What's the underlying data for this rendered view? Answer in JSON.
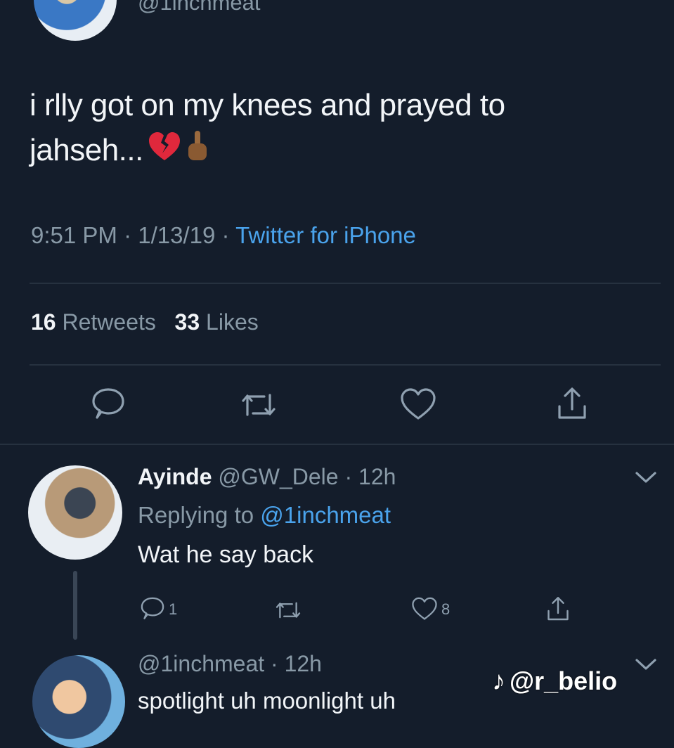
{
  "tweet": {
    "handle": "@1inchmeat",
    "text_line1": "i rlly got on my knees and prayed to",
    "text_line2": "jahseh...",
    "time": "9:51 PM",
    "date": "1/13/19",
    "source": "Twitter for iPhone",
    "retweets_count": "16",
    "retweets_label": "Retweets",
    "likes_count": "33",
    "likes_label": "Likes"
  },
  "reply1": {
    "name": "Ayinde",
    "handle": "@GW_Dele",
    "age": "12h",
    "replying_label": "Replying to",
    "replying_to": "@1inchmeat",
    "text": "Wat he say back",
    "reply_count": "1",
    "like_count": "8"
  },
  "reply2": {
    "handle": "@1inchmeat",
    "age": "12h",
    "text": "spotlight uh moonlight uh"
  },
  "watermark": {
    "logo": "♪",
    "text": "@r_belio"
  },
  "icons": [
    "reply-icon",
    "retweet-icon",
    "like-icon",
    "share-icon",
    "chevron-down-icon",
    "broken-heart-emoji",
    "pointing-up-emoji",
    "tiktok-logo-icon"
  ],
  "colors": {
    "background": "#141d2b",
    "link": "#4aa3ec",
    "muted": "#8899a6",
    "emoji_red": "#e0283c"
  }
}
